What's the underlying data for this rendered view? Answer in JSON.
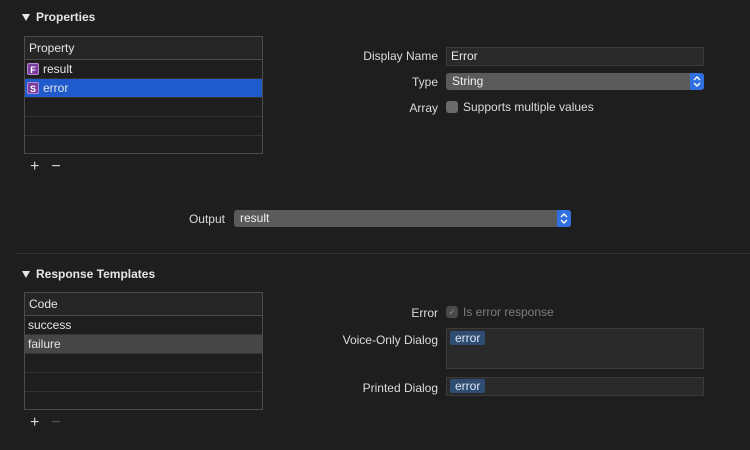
{
  "properties": {
    "title": "Properties",
    "table": {
      "header": "Property",
      "rows": [
        {
          "badge": "F",
          "label": "result"
        },
        {
          "badge": "S",
          "label": "error"
        }
      ]
    },
    "add_label": "+",
    "remove_label": "−",
    "display_name": {
      "label": "Display Name",
      "value": "Error"
    },
    "type": {
      "label": "Type",
      "value": "String"
    },
    "array": {
      "label": "Array",
      "checkbox_label": "Supports multiple values"
    },
    "output": {
      "label": "Output",
      "value": "result"
    }
  },
  "response_templates": {
    "title": "Response Templates",
    "table": {
      "header": "Code",
      "rows": [
        "success",
        "failure"
      ]
    },
    "add_label": "+",
    "remove_label": "−",
    "error": {
      "label": "Error",
      "checkbox_label": "Is error response"
    },
    "voice_only_dialog": {
      "label": "Voice-Only Dialog",
      "token": "error"
    },
    "printed_dialog": {
      "label": "Printed Dialog",
      "token": "error"
    }
  }
}
